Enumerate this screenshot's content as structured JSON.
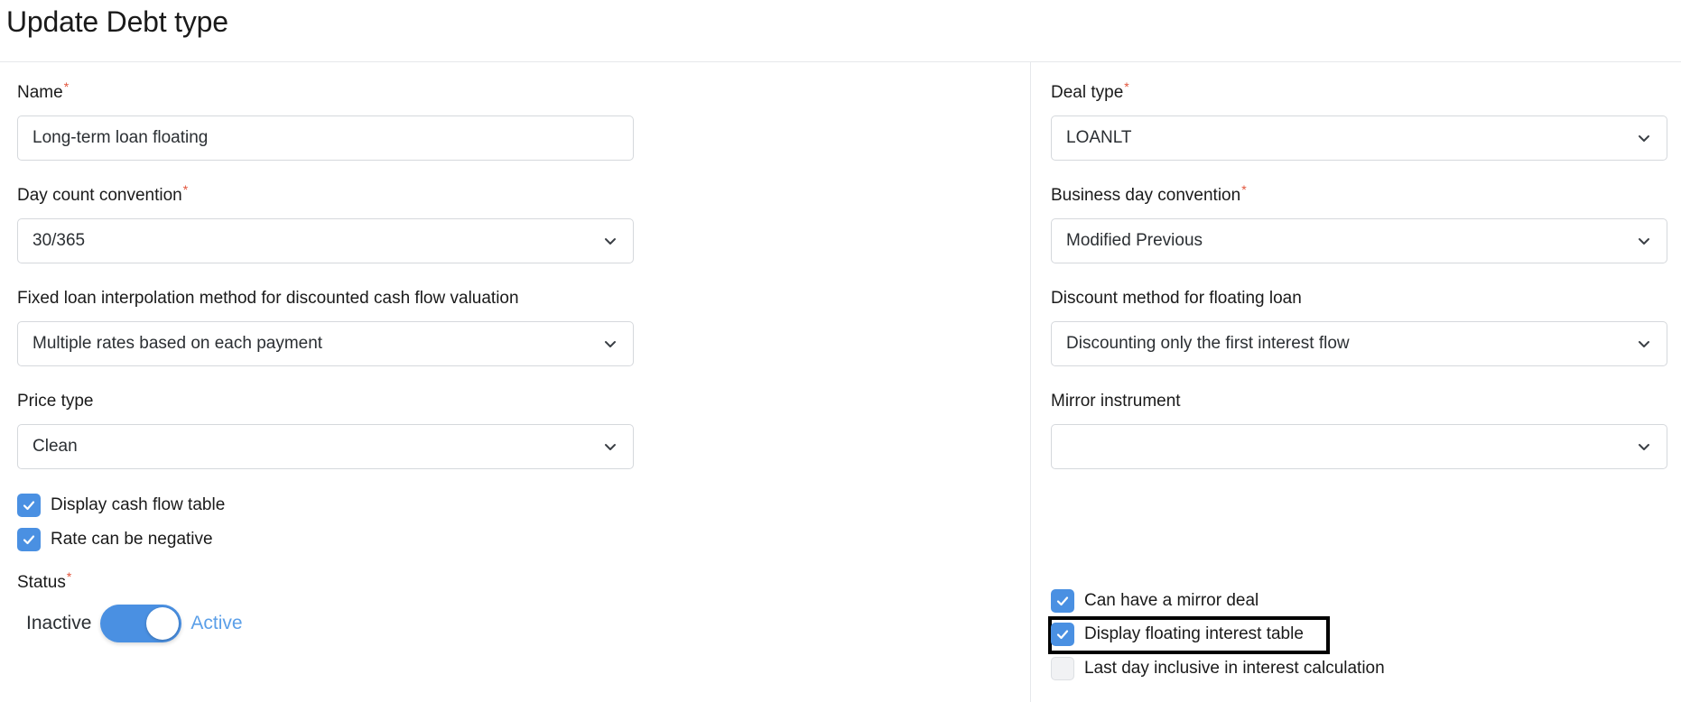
{
  "page": {
    "title": "Update Debt type"
  },
  "left": {
    "name": {
      "label": "Name",
      "required": "*",
      "value": "Long-term loan floating"
    },
    "day_count": {
      "label": "Day count convention",
      "required": "*",
      "value": "30/365"
    },
    "interpolation": {
      "label": "Fixed loan interpolation method for discounted cash flow valuation",
      "value": "Multiple rates based on each payment"
    },
    "price_type": {
      "label": "Price type",
      "value": "Clean"
    },
    "checkboxes": [
      {
        "label": "Display cash flow table",
        "checked": true
      },
      {
        "label": "Rate can be negative",
        "checked": true
      }
    ],
    "status": {
      "label": "Status",
      "required": "*",
      "off_label": "Inactive",
      "on_label": "Active",
      "active": true
    }
  },
  "right": {
    "deal_type": {
      "label": "Deal type",
      "required": "*",
      "value": "LOANLT"
    },
    "business_day": {
      "label": "Business day convention",
      "required": "*",
      "value": "Modified Previous"
    },
    "discount_method": {
      "label": "Discount method for floating loan",
      "value": "Discounting only the first interest flow"
    },
    "mirror_instrument": {
      "label": "Mirror instrument",
      "value": ""
    },
    "checkboxes": [
      {
        "label": "Can have a mirror deal",
        "checked": true
      },
      {
        "label": "Display floating interest table",
        "checked": true
      },
      {
        "label": "Last day inclusive in interest calculation",
        "checked": false
      }
    ]
  },
  "colors": {
    "accent": "#4a90e2",
    "required": "#e2543b",
    "border": "#d5d8dc"
  },
  "icons": {
    "select": "chevron-down-icon",
    "check": "check-icon"
  }
}
